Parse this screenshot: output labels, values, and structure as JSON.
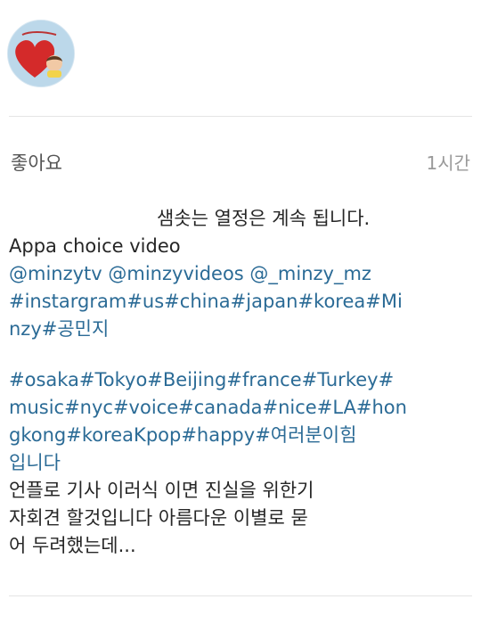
{
  "post": {
    "avatar_icon": "profile-heart-avatar",
    "likes_label": "좋아요",
    "time_label": "1시간"
  },
  "caption": {
    "line1": "샘솟는 열정은 계속 됩니다.",
    "line2": "Appa choice video",
    "line3": "@minzytv @minzyvideos @_minzy_mz",
    "line4": "#instargram#us#china#japan#korea#Mi",
    "line5": "nzy#공민지",
    "line6": "#osaka#Tokyo#Beijing#france#Turkey#",
    "line7": "music#nyc#voice#canada#nice#LA#hon",
    "line8": "gkong#koreaKpop#happy#여러분이힘",
    "line9": "입니다",
    "line10": "언플로 기사 이러식 이면 진실을 위한기",
    "line11": "자회견 할것입니다 아름다운 이별로 묻",
    "line12": "어 두려했는데..."
  },
  "colors": {
    "link": "#2b6b96",
    "text": "#262626",
    "muted": "#999999"
  }
}
